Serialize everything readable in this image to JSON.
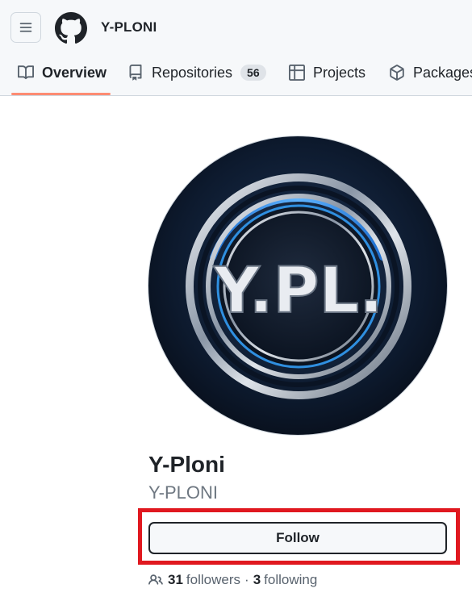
{
  "header": {
    "username": "Y-PLONI"
  },
  "tabs": [
    {
      "label": "Overview",
      "icon": "book-icon",
      "active": true
    },
    {
      "label": "Repositories",
      "icon": "repo-icon",
      "count": "56"
    },
    {
      "label": "Projects",
      "icon": "table-icon"
    },
    {
      "label": "Packages",
      "icon": "package-icon"
    }
  ],
  "profile": {
    "avatar_text": "Y.PL.",
    "display_name": "Y-Ploni",
    "login": "Y-PLONI",
    "follow_label": "Follow",
    "followers_count": "31",
    "followers_label": "followers",
    "separator": "·",
    "following_count": "3",
    "following_label": "following"
  },
  "colors": {
    "tab_underline": "#fd8c73",
    "highlight": "#e0181f",
    "avatar_bg": "#0d1a2e",
    "avatar_ring": "#2f8fe0"
  }
}
